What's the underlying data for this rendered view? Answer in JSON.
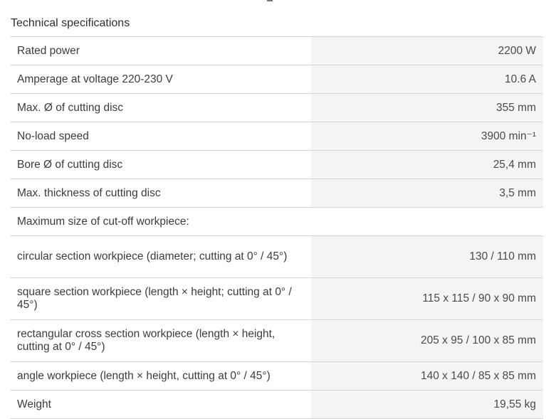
{
  "section": {
    "title": "Technical specifications"
  },
  "specs": [
    {
      "label": "Rated power",
      "value": "2200 W"
    },
    {
      "label": "Amperage at voltage 220-230 V",
      "value": "10.6 A"
    },
    {
      "label": "Max. Ø of cutting disc",
      "value": "355 mm"
    },
    {
      "label": "No-load speed",
      "value": "3900 min⁻¹"
    },
    {
      "label": "Bore Ø of cutting disc",
      "value": "25,4 mm"
    },
    {
      "label": "Max. thickness of cutting disc",
      "value": "3,5 mm"
    },
    {
      "label": "Maximum size of cut-off workpiece:",
      "value": ""
    },
    {
      "label": "circular section workpiece (diameter; cutting at 0° / 45°)",
      "value": "130 / 110 mm"
    },
    {
      "label": "square section workpiece (length × height; cutting at 0° / 45°)",
      "value": "115 x 115 / 90 x 90 mm"
    },
    {
      "label": "rectangular cross section workpiece (length × height, cutting at 0° / 45°)",
      "value": "205 x 95 / 100 x 85 mm"
    },
    {
      "label": "angle workpiece (length × height, cutting at 0° / 45°)",
      "value": "140 x 140 / 85 x 85 mm"
    },
    {
      "label": "Weight",
      "value": "19,55 kg"
    }
  ]
}
